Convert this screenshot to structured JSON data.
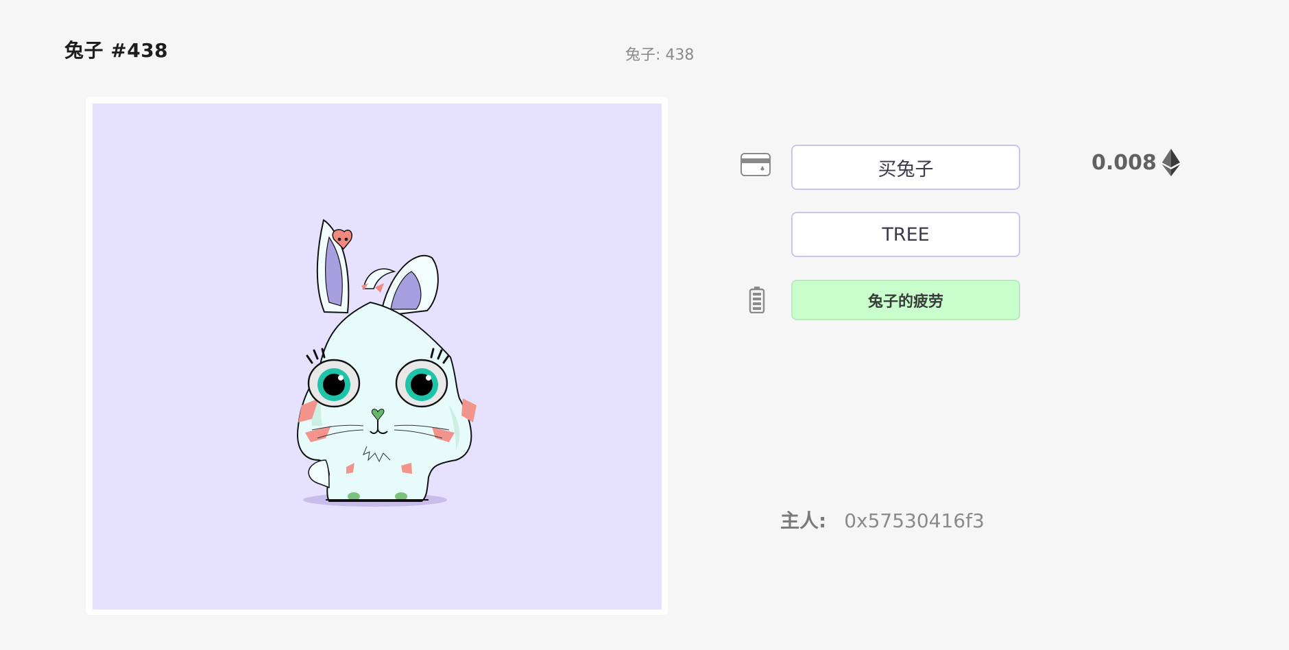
{
  "header": {
    "title": "兔子 #438",
    "subtitle": "兔子: 438"
  },
  "artwork": {
    "icon": "bunny-character-illustration",
    "background_color": "#e6e1fe"
  },
  "actions": {
    "buy_label": "买兔子",
    "tree_label": "TREE",
    "fatigue_label": "兔子的疲劳",
    "buy_icon": "credit-card-icon",
    "fatigue_icon": "battery-icon"
  },
  "price": {
    "value": "0.008",
    "currency_icon": "ethereum-icon"
  },
  "owner": {
    "label": "主人:",
    "address": "0x57530416f3"
  },
  "colors": {
    "button_border": "#c9c6ee",
    "fatigue_bg": "#c8ffcc",
    "page_bg": "#f6f6f6"
  }
}
